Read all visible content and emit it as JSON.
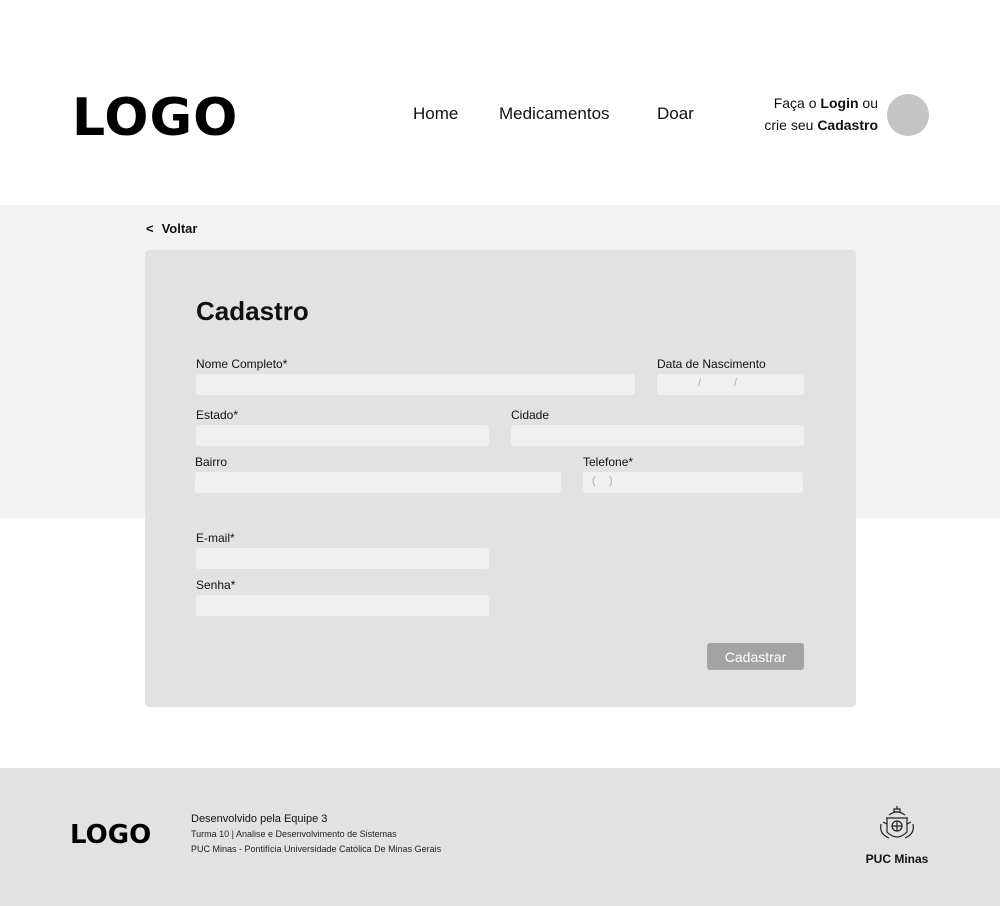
{
  "header": {
    "logo": "LOGO",
    "nav": [
      "Home",
      "Medicamentos",
      "Doar"
    ],
    "auth": {
      "line1_prefix": "Faça o",
      "login": "Login",
      "line1_suffix": "ou",
      "line2_prefix": "crie seu",
      "signup": "Cadastro"
    }
  },
  "back_link": {
    "chevron": "<",
    "label": "Voltar"
  },
  "form": {
    "title": "Cadastro",
    "fields": {
      "nome": {
        "label": "Nome Completo*",
        "value": ""
      },
      "nascimento": {
        "label": "Data de Nascimento",
        "separator": "/"
      },
      "estado": {
        "label": "Estado*",
        "value": ""
      },
      "cidade": {
        "label": "Cidade",
        "value": ""
      },
      "bairro": {
        "label": "Bairro",
        "value": ""
      },
      "telefone": {
        "label": "Telefone*",
        "open_paren": "(",
        "close_paren": ")"
      },
      "email": {
        "label": "E-mail*",
        "value": ""
      },
      "senha": {
        "label": "Senha*",
        "value": ""
      }
    },
    "submit_label": "Cadastrar"
  },
  "footer": {
    "logo": "LOGO",
    "credit": "Desenvolvido pela Equipe 3",
    "line1": "Turma 10 | Analise e Desenvolvimento de Sistemas",
    "line2": "PUC Minas - Pontifícia Universidade Católica De Minas Gerais",
    "institution_logo_text": "PUC Minas"
  },
  "colors": {
    "band": "#f2f2f2",
    "card": "#e2e2e2",
    "input": "#f0f0f0",
    "avatar": "#c4c4c4",
    "button": "#a3a3a3",
    "footer": "#e2e2e2"
  },
  "icons": [
    "user-avatar",
    "back-chevron",
    "puc-minas-crest"
  ]
}
